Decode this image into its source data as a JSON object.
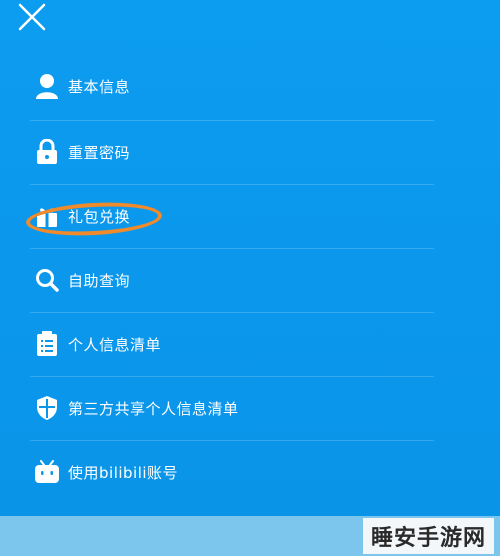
{
  "menu": {
    "items": [
      {
        "label": "基本信息",
        "icon": "user-icon"
      },
      {
        "label": "重置密码",
        "icon": "lock-icon"
      },
      {
        "label": "礼包兑换",
        "icon": "gift-icon"
      },
      {
        "label": "自助查询",
        "icon": "search-icon"
      },
      {
        "label": "个人信息清单",
        "icon": "clipboard-icon"
      },
      {
        "label": "第三方共享个人信息清单",
        "icon": "shield-icon"
      },
      {
        "label": "使用bilibili账号",
        "icon": "bilibili-icon"
      }
    ]
  },
  "watermark": {
    "text": "睡安手游网"
  },
  "colors": {
    "background": "#0a97ea",
    "highlight": "#f08a2a",
    "text": "#ffffff"
  }
}
